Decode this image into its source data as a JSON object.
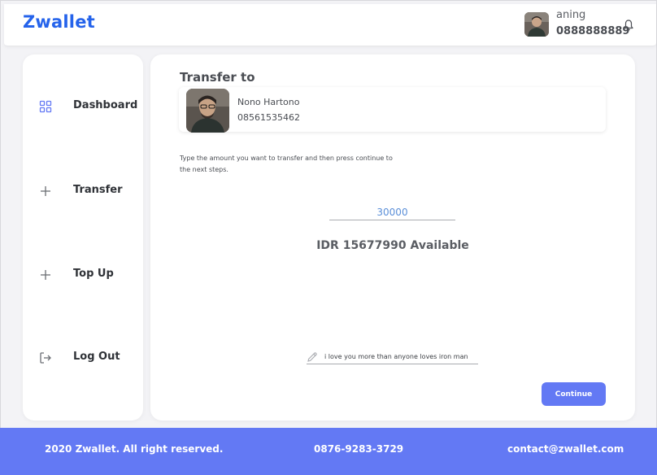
{
  "header": {
    "brand": "Zwallet",
    "user_name": "aning",
    "user_phone": "0888888889",
    "icons": [
      "avatar",
      "bell-icon"
    ]
  },
  "sidebar": {
    "items": [
      {
        "label": "Dashboard",
        "icon": "dashboard-grid-icon"
      },
      {
        "label": "Transfer",
        "icon": "plus-icon"
      },
      {
        "label": "Top Up",
        "icon": "plus-icon"
      },
      {
        "label": "Log Out",
        "icon": "logout-icon"
      }
    ]
  },
  "transfer": {
    "title": "Transfer to",
    "recipient": {
      "name": "Nono Hartono",
      "phone": "08561535462"
    },
    "instructions": "Type the amount you want to transfer and then press continue to the next steps.",
    "amount_value": "30000",
    "balance_text": "IDR 15677990 Available",
    "note_value": "i love you more than anyone loves iron man",
    "continue_label": "Continue"
  },
  "footer": {
    "copyright": "2020 Zwallet. All right reserved.",
    "phone": "0876-9283-3729",
    "email": "contact@zwallet.com"
  },
  "colors": {
    "brand": "#2563eb",
    "accent": "#6379f4",
    "amount_text": "#5b8fd8"
  }
}
